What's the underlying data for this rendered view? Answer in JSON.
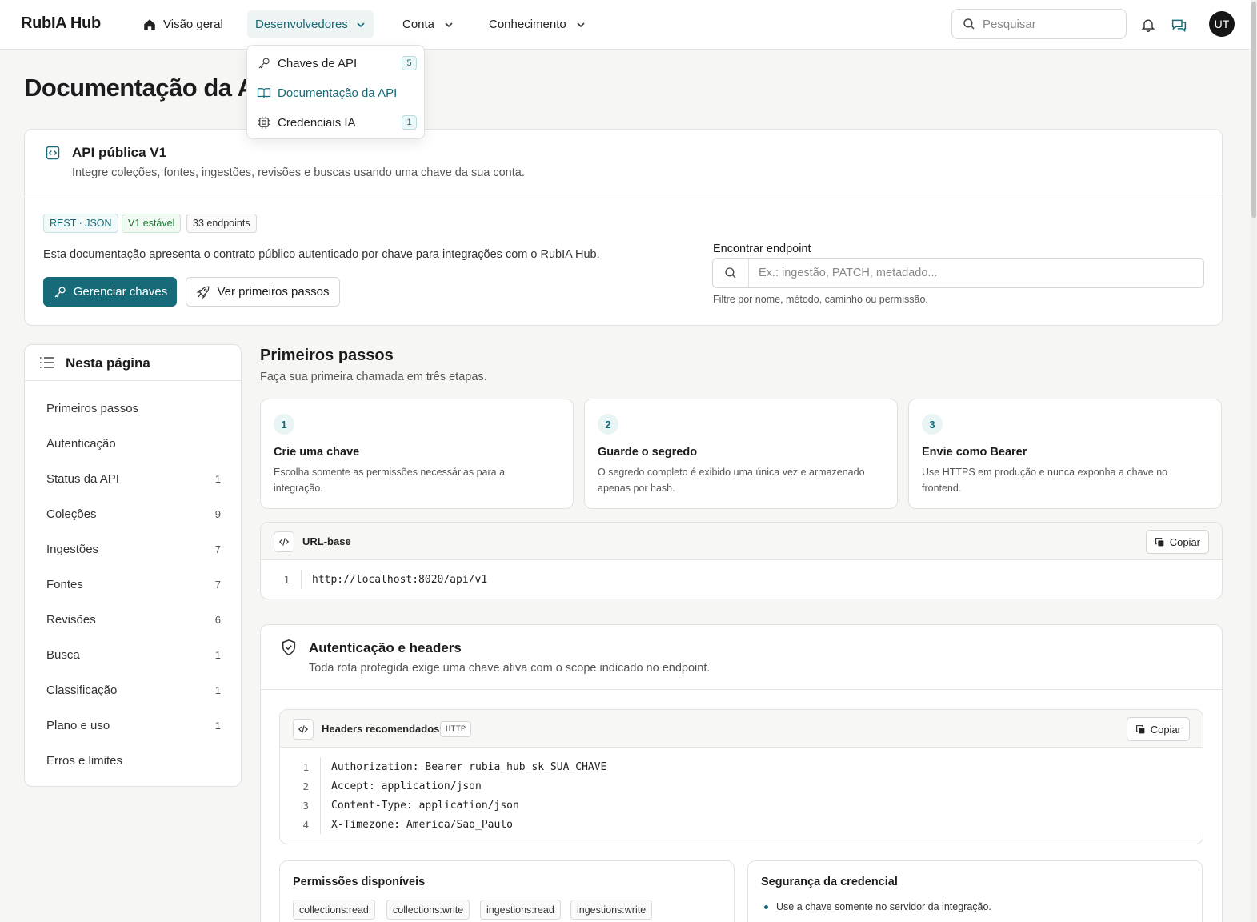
{
  "topbar": {
    "brand": "RubIA Hub",
    "nav": [
      {
        "label": "Visão geral"
      },
      {
        "label": "Desenvolvedores"
      },
      {
        "label": "Conta"
      },
      {
        "label": "Conhecimento"
      }
    ],
    "search_placeholder": "Pesquisar",
    "avatar": "UT"
  },
  "dropdown": {
    "items": [
      {
        "label": "Chaves de API",
        "badge": "5"
      },
      {
        "label": "Documentação da API"
      },
      {
        "label": "Credenciais IA",
        "badge": "1"
      }
    ]
  },
  "page": {
    "title": "Documentação da API"
  },
  "hero": {
    "title": "API pública V1",
    "subtitle": "Integre coleções, fontes, ingestões, revisões e buscas usando uma chave da sua conta.",
    "tags": [
      "REST · JSON",
      "V1 estável",
      "33 endpoints"
    ],
    "description": "Esta documentação apresenta o contrato público autenticado por chave para integrações com o RubIA Hub.",
    "primary_button": "Gerenciar chaves",
    "secondary_button": "Ver primeiros passos",
    "find_label": "Encontrar endpoint",
    "find_placeholder": "Ex.: ingestão, PATCH, metadado...",
    "find_hint": "Filtre por nome, método, caminho ou permissão."
  },
  "toc": {
    "title": "Nesta página",
    "items": [
      {
        "label": "Primeiros passos",
        "count": ""
      },
      {
        "label": "Autenticação",
        "count": ""
      },
      {
        "label": "Status da API",
        "count": "1"
      },
      {
        "label": "Coleções",
        "count": "9"
      },
      {
        "label": "Ingestões",
        "count": "7"
      },
      {
        "label": "Fontes",
        "count": "7"
      },
      {
        "label": "Revisões",
        "count": "6"
      },
      {
        "label": "Busca",
        "count": "1"
      },
      {
        "label": "Classificação",
        "count": "1"
      },
      {
        "label": "Plano e uso",
        "count": "1"
      },
      {
        "label": "Erros e limites",
        "count": ""
      }
    ]
  },
  "getting_started": {
    "title": "Primeiros passos",
    "subtitle": "Faça sua primeira chamada em três etapas.",
    "steps": [
      {
        "num": "1",
        "title": "Crie uma chave",
        "desc": "Escolha somente as permissões necessárias para a integração."
      },
      {
        "num": "2",
        "title": "Guarde o segredo",
        "desc": "O segredo completo é exibido uma única vez e armazenado apenas por hash."
      },
      {
        "num": "3",
        "title": "Envie como Bearer",
        "desc": "Use HTTPS em produção e nunca exponha a chave no frontend."
      }
    ]
  },
  "base_url": {
    "title": "URL-base",
    "copy": "Copiar",
    "lines": [
      {
        "n": "1",
        "code": "http://localhost:8020/api/v1"
      }
    ]
  },
  "auth": {
    "title": "Autenticação e headers",
    "subtitle": "Toda rota protegida exige uma chave ativa com o scope indicado no endpoint.",
    "headers_title": "Headers recomendados",
    "headers_pill": "HTTP",
    "copy": "Copiar",
    "lines": [
      {
        "n": "1",
        "code": "Authorization: Bearer rubia_hub_sk_SUA_CHAVE"
      },
      {
        "n": "2",
        "code": "Accept: application/json"
      },
      {
        "n": "3",
        "code": "Content-Type: application/json"
      },
      {
        "n": "4",
        "code": "X-Timezone: America/Sao_Paulo"
      }
    ],
    "permissions_title": "Permissões disponíveis",
    "permissions": [
      "collections:read",
      "collections:write",
      "ingestions:read",
      "ingestions:write"
    ],
    "security_title": "Segurança da credencial",
    "security_items": [
      "Use a chave somente no servidor da integração."
    ]
  }
}
